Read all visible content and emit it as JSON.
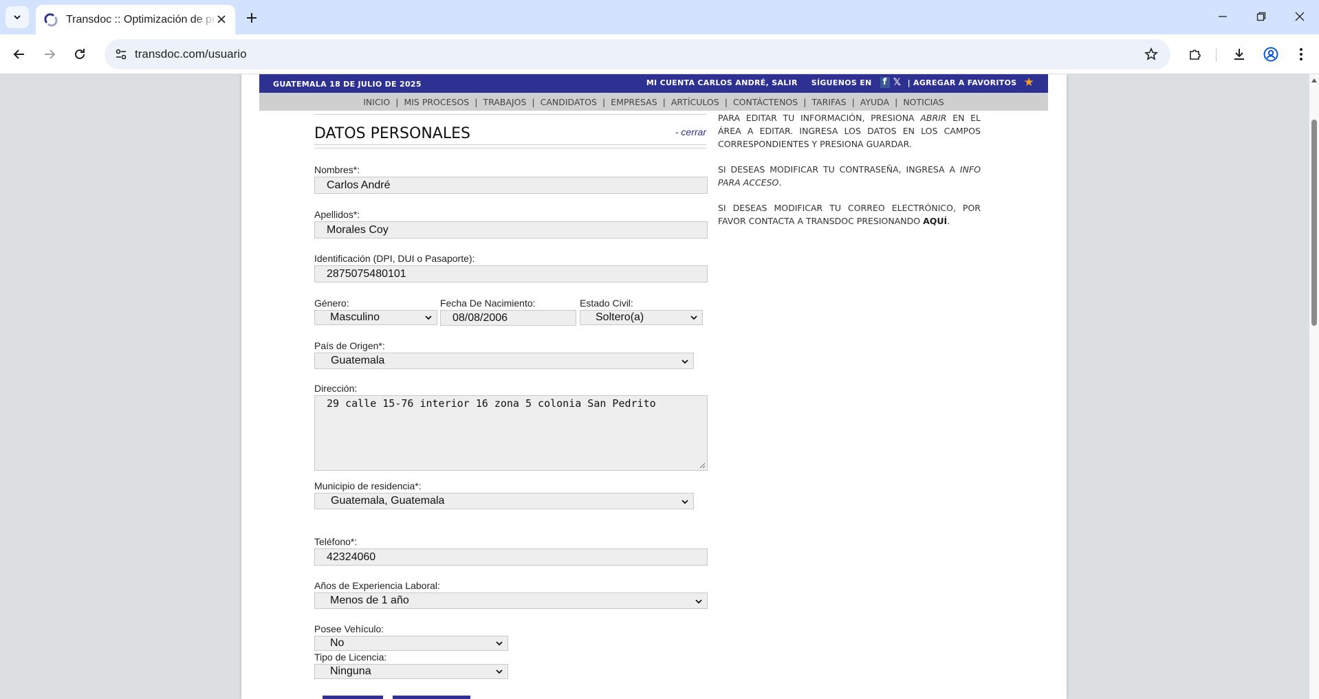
{
  "browser": {
    "tab_title": "Transdoc :: Optimización de procesos",
    "url": "transdoc.com/usuario"
  },
  "header": {
    "date": "GUATEMALA 18 DE JULIO DE 2025",
    "account": "MI CUENTA CARLOS ANDRÉ, SALIR",
    "follow": "SÍGUENOS EN",
    "favorites": "| AGREGAR A FAVORITOS"
  },
  "nav": {
    "items": [
      "INICIO",
      "MIS PROCESOS",
      "TRABAJOS",
      "CANDIDATOS",
      "EMPRESAS",
      "ARTÍCULOS",
      "CONTÁCTENOS",
      "TARIFAS",
      "AYUDA",
      "NOTICIAS"
    ]
  },
  "form": {
    "title": "DATOS PERSONALES",
    "close": "- cerrar",
    "nombres_label": "Nombres*:",
    "nombres_value": "Carlos André",
    "apellidos_label": "Apellidos*:",
    "apellidos_value": "Morales Coy",
    "id_label": "Identificación (DPI, DUI o Pasaporte):",
    "id_value": "2875075480101",
    "genero_label": "Género:",
    "genero_value": "Masculino",
    "fecha_label": "Fecha De Nacimiento:",
    "fecha_value": "08/08/2006",
    "civil_label": "Estado Civil:",
    "civil_value": "Soltero(a)",
    "pais_label": "País de Origen*:",
    "pais_value": "Guatemala",
    "direccion_label": "Dirección:",
    "direccion_value": "29 calle 15-76 interior 16 zona 5 colonia San Pedrito",
    "municipio_label": "Municipio de residencia*:",
    "municipio_value": "Guatemala, Guatemala",
    "telefono_label": "Teléfono*:",
    "telefono_value": "42324060",
    "experiencia_label": "Años de Experiencia Laboral:",
    "experiencia_value": "Menos de 1 año",
    "vehiculo_label": "Posee Vehículo:",
    "vehiculo_value": "No",
    "licencia_label": "Tipo de Licencia:",
    "licencia_value": "Ninguna"
  },
  "help": {
    "p1_a": "PARA EDITAR TU INFORMACIÓN, PRESIONA ",
    "p1_em": "ABRIR",
    "p1_b": " EN EL ÁREA A EDITAR. INGRESA LOS DATOS EN LOS CAMPOS CORRESPONDIENTES Y PRESIONA GUARDAR.",
    "p2_a": "SI DESEAS MODIFICAR TU CONTRASEÑA, INGRESA A ",
    "p2_em": "INFO PARA ACCESO",
    "p2_b": ".",
    "p3_a": "SI DESEAS MODIFICAR TU CORREO ELECTRÓNICO, POR FAVOR CONTACTA A TRANSDOC PRESIONANDO ",
    "p3_link": "AQUÍ",
    "p3_b": "."
  },
  "colors": {
    "brand_blue": "#2e3192",
    "nav_gray": "#cfcfcf",
    "field_bg": "#eeeeee"
  }
}
